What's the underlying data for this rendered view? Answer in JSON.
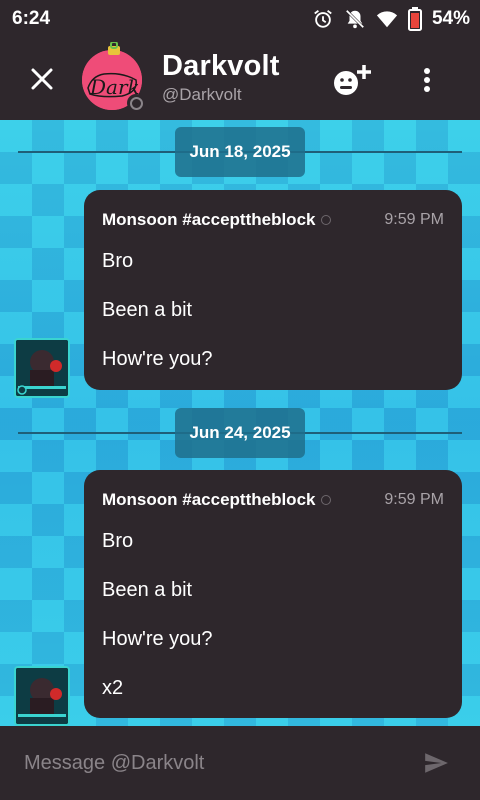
{
  "status_bar": {
    "time": "6:24",
    "battery": "54%"
  },
  "header": {
    "name": "Darkvolt",
    "handle": "@Darkvolt",
    "avatar_text": "Dark"
  },
  "messages": [
    {
      "date": "Jun 18, 2025",
      "author": "Monsoon #accepttheblock",
      "time": "9:59 PM",
      "lines": [
        "Bro",
        "Been a bit",
        "How're you?"
      ]
    },
    {
      "date": "Jun 24, 2025",
      "author": "Monsoon #accepttheblock",
      "time": "9:59 PM",
      "lines": [
        "Bro",
        "Been a bit",
        "How're you?",
        "x2"
      ]
    }
  ],
  "input": {
    "placeholder": "Message @Darkvolt"
  },
  "colors": {
    "background": "#2e272c",
    "chat_bg": "#37c9e8",
    "accent_pill": "#1e6e8c"
  }
}
